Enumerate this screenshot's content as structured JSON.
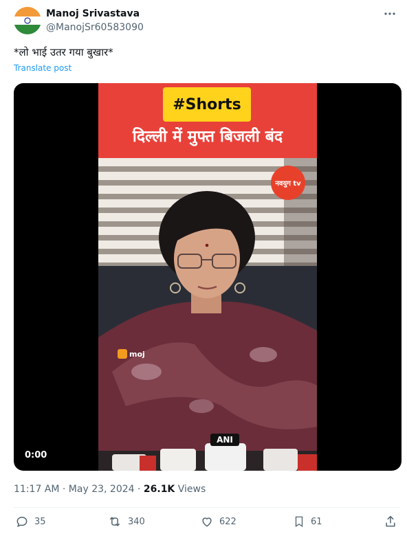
{
  "post": {
    "author_name": "Manoj Srivastava",
    "author_handle": "@ManojSr60583090",
    "text": "*लो भाई उतर गया बुखार*",
    "translate_label": "Translate post",
    "time": "11:17 AM · May 23, 2024 · ",
    "views_count": "26.1K",
    "views_label": " Views"
  },
  "media": {
    "tag_text": "#Shorts",
    "headline_text": "दिल्ली में मुफ्त बिजली बंद",
    "channel_logo_text": "नवयुग tv",
    "watermark_text": "moj",
    "mic_label": "ANI",
    "video_time": "0:00"
  },
  "actions": {
    "replies": "35",
    "reposts": "340",
    "likes": "622",
    "bookmarks": "61"
  },
  "colors": {
    "accent": "#1d9bf0",
    "text_secondary": "#536471",
    "banner_red": "#e8413a",
    "tag_yellow": "#ffd21b"
  }
}
